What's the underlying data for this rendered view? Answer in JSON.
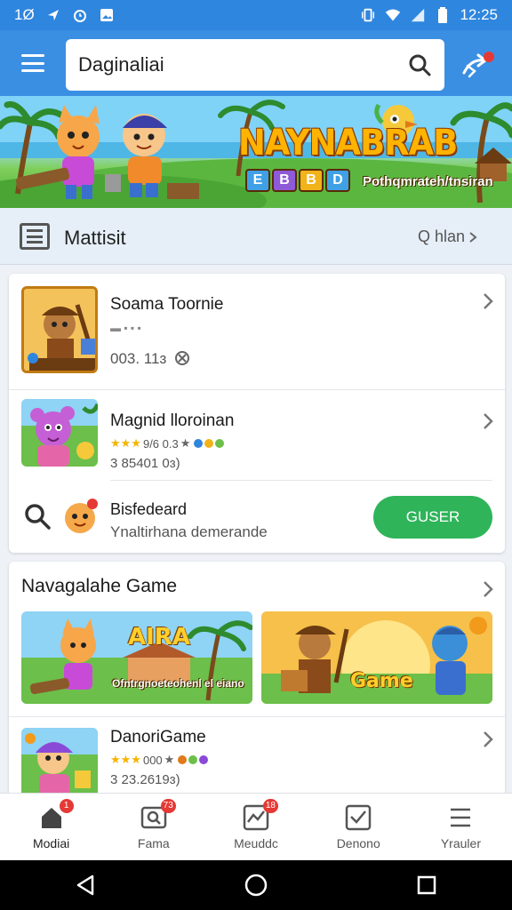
{
  "status_bar": {
    "left_text": "1Ø",
    "time": "12:25"
  },
  "search": {
    "value": "Daginaliai"
  },
  "banner": {
    "title": "NAYNABRAB",
    "blocks": [
      "E",
      "B",
      "B",
      "D"
    ],
    "subtitle": "Pothqmrateh/tnsiran"
  },
  "section": {
    "title": "Mattisit",
    "link": "Q hlan"
  },
  "list": [
    {
      "title": "Soama Toornie",
      "meta_dots": "▬ ▪ ▪ ▪",
      "meta": "003. 11ɜ"
    },
    {
      "title": "Magnid lloroinan",
      "rating": "9/6 0.3",
      "meta": "3 85401 0ɜ)"
    },
    {
      "title": "Bisfedeard",
      "subtitle": "Ynaltirhana demerande",
      "button": "GUSER"
    }
  ],
  "games_section": {
    "title": "Navagalahe Game",
    "tile1_label": "AIRA",
    "tile1_sub": "Ofntrgnoeteohenl el eiano",
    "tile2_label": "Game",
    "item": {
      "title": "DanoriGame",
      "rating": "000",
      "meta": "3 23.2619ɜ)"
    }
  },
  "bottom_nav": [
    {
      "label": "Modiai",
      "icon": "home-icon",
      "badge": "1"
    },
    {
      "label": "Fama",
      "icon": "search-card-icon",
      "badge": "73"
    },
    {
      "label": "Meuddc",
      "icon": "chart-icon",
      "badge": "18"
    },
    {
      "label": "Denono",
      "icon": "check-chart-icon",
      "badge": ""
    },
    {
      "label": "Yrauler",
      "icon": "menu-icon",
      "badge": ""
    }
  ],
  "colors": {
    "app_bar": "#3b8fe2",
    "status_bar": "#2f86de",
    "install_button": "#2fb45a",
    "badge": "#e53935"
  }
}
